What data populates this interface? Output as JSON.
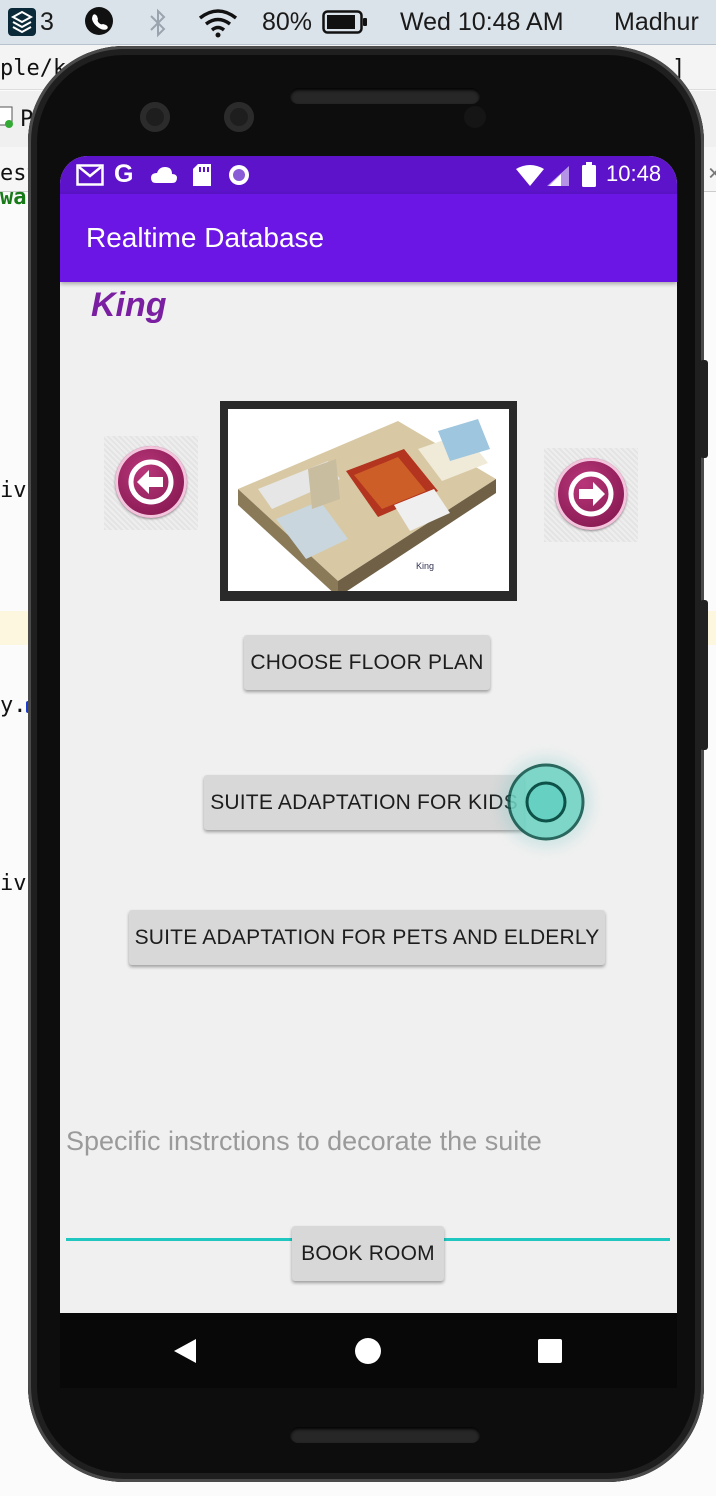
{
  "mac_menubar": {
    "stack_count": "3",
    "battery": "80%",
    "clock": "Wed 10:48 AM",
    "user": "Madhur"
  },
  "ide_fragments": {
    "path": "ple/k",
    "tab": "P",
    "line_est": "est",
    "line_wa": "wa",
    "line_ivi1": "ivi",
    "line_y": "y.",
    "line_ivi2": "ivi"
  },
  "status_bar": {
    "time": "10:48"
  },
  "app_bar": {
    "title": "Realtime Database"
  },
  "room": {
    "name": "King",
    "floorplan_caption": "King"
  },
  "buttons": {
    "choose_floor_plan": "CHOOSE FLOOR PLAN",
    "suite_kids": "SUITE ADAPTATION FOR KIDS",
    "suite_pets": "SUITE ADAPTATION FOR PETS AND ELDERLY",
    "book_room": "BOOK ROOM"
  },
  "instructions": {
    "placeholder": "Specific instrctions to decorate the suite"
  },
  "colors": {
    "status_bar": "#5c13c9",
    "app_bar": "#6c16e6",
    "room_title": "#7b1fa2",
    "arrow_button": "#9c2564",
    "input_underline": "#20c7c0"
  },
  "icons": [
    "layers-icon",
    "viber-icon",
    "bluetooth-icon",
    "wifi-icon",
    "battery-icon",
    "gmail-icon",
    "google-icon",
    "cloud-icon",
    "sd-card-icon",
    "record-icon",
    "signal-icon",
    "arrow-left-icon",
    "arrow-right-icon",
    "back-icon",
    "home-icon",
    "recents-icon"
  ]
}
